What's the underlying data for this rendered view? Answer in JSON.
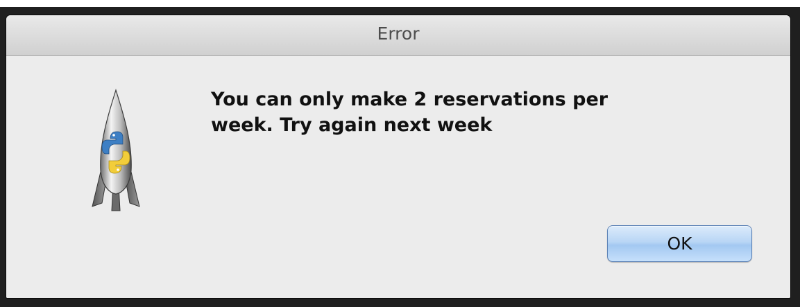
{
  "dialog": {
    "title": "Error",
    "message_line1": "You can only make 2 reservations per",
    "message_line2": "week. Try again next week",
    "ok_label": "OK",
    "icon": "python-rocket-icon"
  },
  "colors": {
    "background": "#1f1f1f",
    "dialog_body": "#ececec",
    "button_blue": "#a3c8f1"
  }
}
